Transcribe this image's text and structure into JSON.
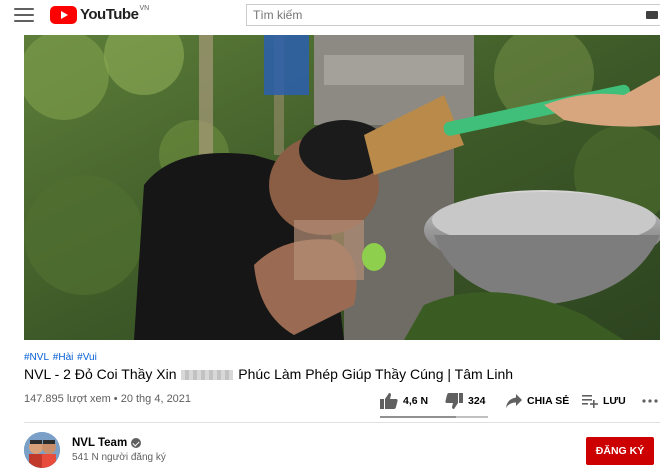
{
  "header": {
    "logo_text": "YouTube",
    "logo_region": "VN",
    "search_placeholder": "Tìm kiếm"
  },
  "video": {
    "hashtags": [
      "#NVL",
      "#Hài",
      "#Vui"
    ],
    "title_before": "NVL - 2 Đỏ Coi Thầy Xin",
    "title_after": "Phúc Làm Phép Giúp Thầy Cúng | Tâm Linh",
    "views_date": "147.895 lượt xem • 20 thg 4, 2021"
  },
  "actions": {
    "like_count": "4,6 N",
    "dislike_count": "324",
    "share_label": "CHIA SẺ",
    "save_label": "LƯU",
    "like_ratio": 0.7
  },
  "channel": {
    "name": "NVL Team",
    "subscribers": "541 N người đăng ký",
    "subscribe_label": "ĐĂNG KÝ"
  },
  "colors": {
    "brand_red": "#ff0000",
    "subscribe_red": "#cc0000",
    "link_blue": "#065fd4"
  }
}
